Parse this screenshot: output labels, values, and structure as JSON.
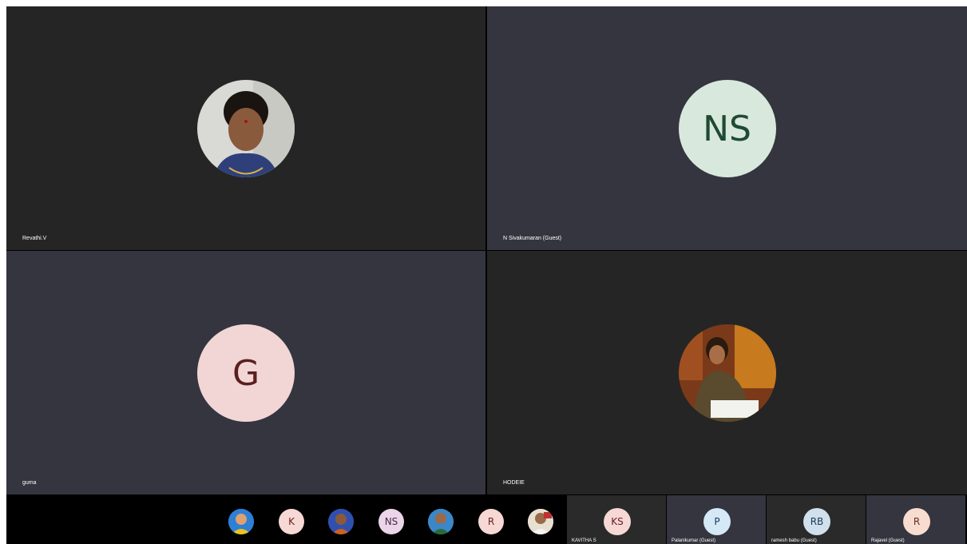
{
  "tiles": [
    {
      "name": "Revathi.V",
      "avatar": "photo-woman-1"
    },
    {
      "name": "N Sivakumaran (Guest)",
      "initials": "NS"
    },
    {
      "name": "guma",
      "initials": "G"
    },
    {
      "name": "HODEIE",
      "avatar": "photo-woman-2"
    }
  ],
  "strip": {
    "small_avatars": [
      "photo",
      "K",
      "photo",
      "NS",
      "photo",
      "R",
      "photo"
    ],
    "mini_tiles": [
      {
        "initials": "KS",
        "name": "KAVITHA S"
      },
      {
        "initials": "P",
        "name": "Palanikumar (Guest)"
      },
      {
        "initials": "RB",
        "name": "ramesh babu (Guest)"
      },
      {
        "initials": "R",
        "name": "Rajavel (Guest)"
      }
    ]
  },
  "colors": {
    "dark_tile": "#252525",
    "slate_tile": "#35353f",
    "ns_bg": "#d8e8dc",
    "ns_fg": "#1e4a33",
    "g_bg": "#f2d6d6",
    "g_fg": "#5a1f1f"
  }
}
